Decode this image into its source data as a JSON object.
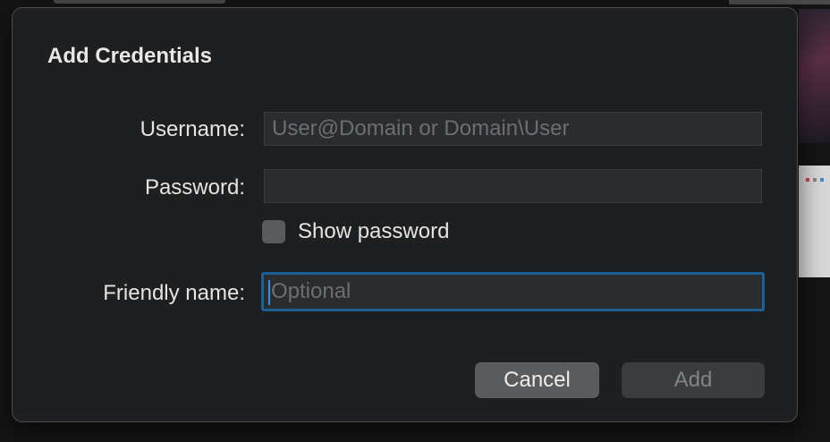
{
  "dialog": {
    "title": "Add Credentials",
    "username": {
      "label": "Username:",
      "value": "",
      "placeholder": "User@Domain or Domain\\User"
    },
    "password": {
      "label": "Password:",
      "value": "",
      "placeholder": ""
    },
    "show_password": {
      "label": "Show password",
      "checked": false
    },
    "friendly_name": {
      "label": "Friendly name:",
      "value": "",
      "placeholder": "Optional"
    },
    "buttons": {
      "cancel": "Cancel",
      "add": "Add"
    }
  },
  "colors": {
    "dialog_background": "#1e1f20",
    "focus_ring": "#1c5f95",
    "button_primary_disabled": "#3b3c3e",
    "button_secondary": "#5a5b5d"
  }
}
